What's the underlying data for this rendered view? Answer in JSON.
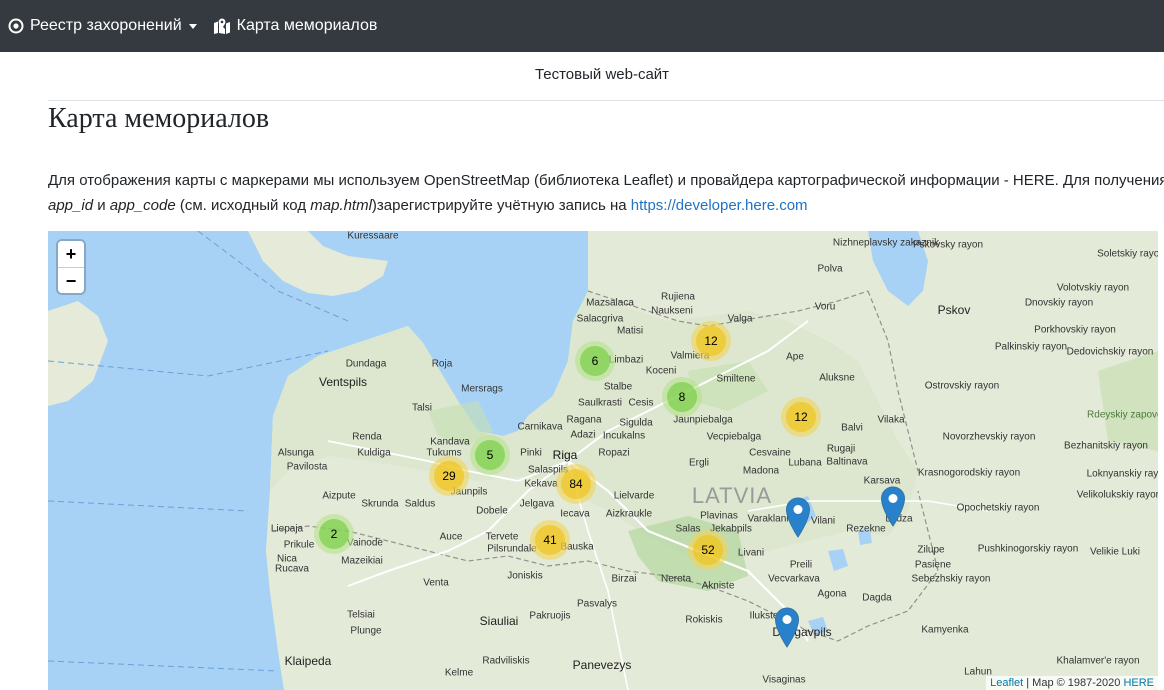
{
  "navbar": {
    "registry_label": "Реестр захоронений",
    "map_label": "Карта мемориалов"
  },
  "header": {
    "site_title": "Тестовый web-сайт",
    "page_title": "Карта мемориалов"
  },
  "description": {
    "line1": "Для отображения карты с маркерами мы используем OpenStreetMap (библиотека Leaflet) и провайдера картографической информации - HERE. Для получения своего",
    "app_id": "app_id",
    "and": " и ",
    "app_code": "app_code",
    "middle": " (см. исходный код ",
    "map_html": "map.html",
    "after": ")зарегистрируйте учётную запись на ",
    "link": "https://developer.here.com"
  },
  "map": {
    "zoom_in": "+",
    "zoom_out": "−",
    "attribution_leaflet": "Leaflet",
    "attribution_text": " | Map © 1987-2020 ",
    "attribution_here": "HERE",
    "country_label": "LATVIA",
    "clusters": [
      {
        "count": "6",
        "size": "small"
      },
      {
        "count": "12",
        "size": "medium"
      },
      {
        "count": "8",
        "size": "small"
      },
      {
        "count": "12",
        "size": "medium"
      },
      {
        "count": "5",
        "size": "small"
      },
      {
        "count": "29",
        "size": "medium"
      },
      {
        "count": "84",
        "size": "medium"
      },
      {
        "count": "2",
        "size": "small"
      },
      {
        "count": "41",
        "size": "medium"
      },
      {
        "count": "52",
        "size": "medium"
      }
    ],
    "places": [
      "Kuressaare",
      "Mazsalaca",
      "Rujiena",
      "Naukseni",
      "Valga",
      "Salacgriva",
      "Matisi",
      "Limbazi",
      "Valmiera",
      "Ape",
      "Koceni",
      "Smiltene",
      "Stalbe",
      "Cesis",
      "Saulkrasti",
      "Aluksne",
      "Dundaga",
      "Roja",
      "Ventspils",
      "Mersrags",
      "Talsi",
      "Carnikava",
      "Ragana",
      "Sigulda",
      "Jaunpiebalga",
      "Adazi",
      "Incukalns",
      "Vecpiebalga",
      "Balvi",
      "Vilaka",
      "Alsunga",
      "Renda",
      "Kandava",
      "Tukums",
      "Kuldiga",
      "Pinki",
      "Riga",
      "Ropazi",
      "Rugaji",
      "Pavilosta",
      "Salaspils",
      "Ergli",
      "Cesvaine",
      "Lubana",
      "Baltinava",
      "Madona",
      "Kekava",
      "Lielvarde",
      "Aizpute",
      "Jaunpils",
      "Saldus",
      "Skrunda",
      "Dobele",
      "Jelgava",
      "Iecava",
      "Aizkraukle",
      "Plavinas",
      "Varaklani",
      "Vilani",
      "Rezekne",
      "Liepaja",
      "Prikule",
      "Vainode",
      "Auce",
      "Tervete",
      "Pilsrundale",
      "Bauska",
      "Salas",
      "Jekabpils",
      "Livani",
      "Zilupe",
      "Nica",
      "Mazeikiai",
      "Birzai",
      "Nereta",
      "Akniste",
      "Preili",
      "Pasiene",
      "Rucava",
      "Venta",
      "Joniskis",
      "Vecvarkava",
      "Sebezhskiy rayon",
      "Agona",
      "Dagda",
      "Pasvalys",
      "Telsiai",
      "Siauliai",
      "Pakruojis",
      "Rokiskis",
      "Ilukste",
      "Daugavpils",
      "Kamyenka",
      "Plunge",
      "Klaipeda",
      "Kelme",
      "Radviliskis",
      "Panevezys",
      "Visaginas",
      "Lahun",
      "Pskov",
      "Pskovsky rayon",
      "Volotvskiy rayon",
      "Soletskiy rayon",
      "Dnovskiy rayon",
      "Porkhovskiy rayon",
      "Dedovichskiy rayon",
      "Palkinskiy rayon",
      "Ostrovskiy rayon",
      "Novorzhevskiy rayon",
      "Bezhanitskiy rayon",
      "Krasnogorodskiy rayon",
      "Loknyanskiy rayon",
      "Velikolukskiy rayon",
      "Opochetskiy rayon",
      "Pushkinogorskiy rayon",
      "Velikie Luki",
      "Karsava",
      "Ludza",
      "Polva",
      "Voru",
      "Rdeyskiy zapovednik",
      "Nizhneplavsky zakaznik",
      "Khalamver'e rayon"
    ]
  }
}
